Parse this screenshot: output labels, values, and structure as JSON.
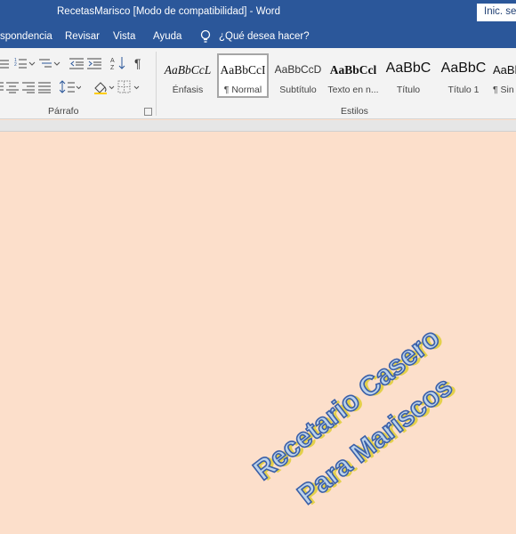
{
  "titlebar": {
    "title": "RecetasMarisco [Modo de compatibilidad]  -  Word",
    "signin": "Inic. ses"
  },
  "menu": {
    "tabs": [
      "spondencia",
      "Revisar",
      "Vista",
      "Ayuda"
    ],
    "tell_me": "¿Qué desea hacer?"
  },
  "ribbon": {
    "paragraph_group": "Párrafo",
    "styles_group": "Estilos",
    "styles": [
      {
        "preview": "AaBbCcL",
        "label": "Énfasis"
      },
      {
        "preview": "AaBbCcI",
        "label": "¶ Normal",
        "selected": true
      },
      {
        "preview": "AaBbCcD",
        "label": "Subtítulo"
      },
      {
        "preview": "AaBbCcl",
        "label": "Texto en n..."
      },
      {
        "preview": "AaBbC",
        "label": "Título"
      },
      {
        "preview": "AaBbC",
        "label": "Título 1"
      },
      {
        "preview": "AaBb",
        "label": "¶ Sin e"
      }
    ]
  },
  "document": {
    "background": "#fcdfcb",
    "wordart_line1": "Recetario Casero",
    "wordart_line2": "Para Mariscos",
    "wordart_fill": "#bcd3ea",
    "wordart_stroke": "#3a5fa8",
    "wordart_shadow": "#e3d04a"
  },
  "colors": {
    "accent": "#2b579a"
  }
}
